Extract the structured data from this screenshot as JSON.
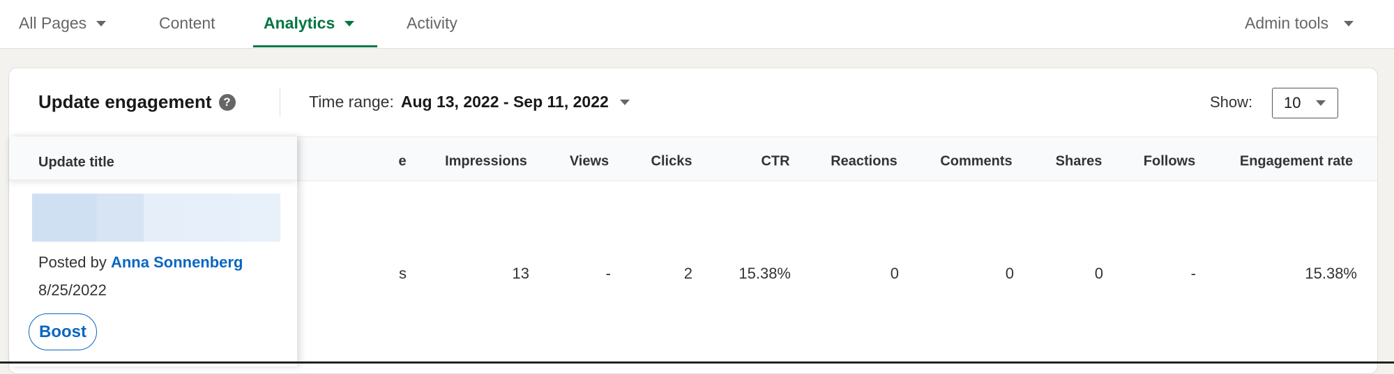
{
  "nav": {
    "items": [
      {
        "label": "All Pages",
        "dropdown": true
      },
      {
        "label": "Content",
        "dropdown": false
      },
      {
        "label": "Analytics",
        "dropdown": true,
        "active": true
      },
      {
        "label": "Activity",
        "dropdown": false
      }
    ],
    "admin_tools": "Admin tools",
    "accent_color": "#057642"
  },
  "card": {
    "title": "Update engagement",
    "help_icon": "?",
    "time_range_label": "Time range:",
    "time_range_value": "Aug 13, 2022 - Sep 11, 2022",
    "show_label": "Show:",
    "show_value": "10"
  },
  "table": {
    "sticky_header": "Update title",
    "partial_header": "e",
    "columns": [
      "Impressions",
      "Views",
      "Clicks",
      "CTR",
      "Reactions",
      "Comments",
      "Shares",
      "Follows",
      "Engagement rate"
    ],
    "rows": [
      {
        "posted_by_label": "Posted by",
        "author": "Anna Sonnenberg",
        "date": "8/25/2022",
        "boost_label": "Boost",
        "partial_cell": "s",
        "values": [
          "13",
          "-",
          "2",
          "15.38%",
          "0",
          "0",
          "0",
          "-",
          "15.38%"
        ]
      }
    ]
  }
}
